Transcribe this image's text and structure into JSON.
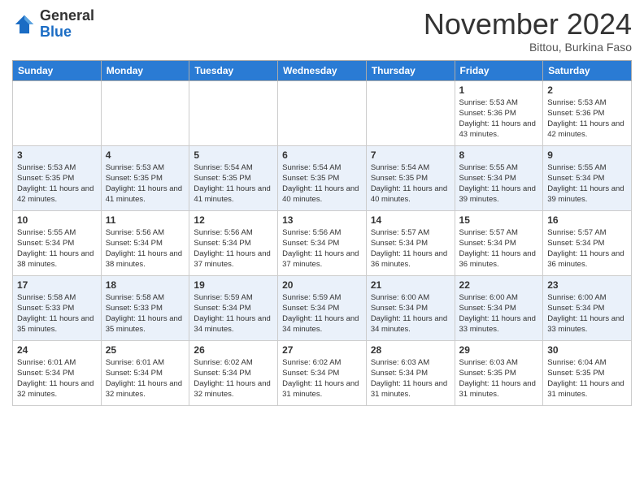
{
  "header": {
    "logo_general": "General",
    "logo_blue": "Blue",
    "month_title": "November 2024",
    "location": "Bittou, Burkina Faso"
  },
  "weekdays": [
    "Sunday",
    "Monday",
    "Tuesday",
    "Wednesday",
    "Thursday",
    "Friday",
    "Saturday"
  ],
  "weeks": [
    [
      {
        "day": "",
        "info": ""
      },
      {
        "day": "",
        "info": ""
      },
      {
        "day": "",
        "info": ""
      },
      {
        "day": "",
        "info": ""
      },
      {
        "day": "",
        "info": ""
      },
      {
        "day": "1",
        "info": "Sunrise: 5:53 AM\nSunset: 5:36 PM\nDaylight: 11 hours\nand 43 minutes."
      },
      {
        "day": "2",
        "info": "Sunrise: 5:53 AM\nSunset: 5:36 PM\nDaylight: 11 hours\nand 42 minutes."
      }
    ],
    [
      {
        "day": "3",
        "info": "Sunrise: 5:53 AM\nSunset: 5:35 PM\nDaylight: 11 hours\nand 42 minutes."
      },
      {
        "day": "4",
        "info": "Sunrise: 5:53 AM\nSunset: 5:35 PM\nDaylight: 11 hours\nand 41 minutes."
      },
      {
        "day": "5",
        "info": "Sunrise: 5:54 AM\nSunset: 5:35 PM\nDaylight: 11 hours\nand 41 minutes."
      },
      {
        "day": "6",
        "info": "Sunrise: 5:54 AM\nSunset: 5:35 PM\nDaylight: 11 hours\nand 40 minutes."
      },
      {
        "day": "7",
        "info": "Sunrise: 5:54 AM\nSunset: 5:35 PM\nDaylight: 11 hours\nand 40 minutes."
      },
      {
        "day": "8",
        "info": "Sunrise: 5:55 AM\nSunset: 5:34 PM\nDaylight: 11 hours\nand 39 minutes."
      },
      {
        "day": "9",
        "info": "Sunrise: 5:55 AM\nSunset: 5:34 PM\nDaylight: 11 hours\nand 39 minutes."
      }
    ],
    [
      {
        "day": "10",
        "info": "Sunrise: 5:55 AM\nSunset: 5:34 PM\nDaylight: 11 hours\nand 38 minutes."
      },
      {
        "day": "11",
        "info": "Sunrise: 5:56 AM\nSunset: 5:34 PM\nDaylight: 11 hours\nand 38 minutes."
      },
      {
        "day": "12",
        "info": "Sunrise: 5:56 AM\nSunset: 5:34 PM\nDaylight: 11 hours\nand 37 minutes."
      },
      {
        "day": "13",
        "info": "Sunrise: 5:56 AM\nSunset: 5:34 PM\nDaylight: 11 hours\nand 37 minutes."
      },
      {
        "day": "14",
        "info": "Sunrise: 5:57 AM\nSunset: 5:34 PM\nDaylight: 11 hours\nand 36 minutes."
      },
      {
        "day": "15",
        "info": "Sunrise: 5:57 AM\nSunset: 5:34 PM\nDaylight: 11 hours\nand 36 minutes."
      },
      {
        "day": "16",
        "info": "Sunrise: 5:57 AM\nSunset: 5:34 PM\nDaylight: 11 hours\nand 36 minutes."
      }
    ],
    [
      {
        "day": "17",
        "info": "Sunrise: 5:58 AM\nSunset: 5:33 PM\nDaylight: 11 hours\nand 35 minutes."
      },
      {
        "day": "18",
        "info": "Sunrise: 5:58 AM\nSunset: 5:33 PM\nDaylight: 11 hours\nand 35 minutes."
      },
      {
        "day": "19",
        "info": "Sunrise: 5:59 AM\nSunset: 5:34 PM\nDaylight: 11 hours\nand 34 minutes."
      },
      {
        "day": "20",
        "info": "Sunrise: 5:59 AM\nSunset: 5:34 PM\nDaylight: 11 hours\nand 34 minutes."
      },
      {
        "day": "21",
        "info": "Sunrise: 6:00 AM\nSunset: 5:34 PM\nDaylight: 11 hours\nand 34 minutes."
      },
      {
        "day": "22",
        "info": "Sunrise: 6:00 AM\nSunset: 5:34 PM\nDaylight: 11 hours\nand 33 minutes."
      },
      {
        "day": "23",
        "info": "Sunrise: 6:00 AM\nSunset: 5:34 PM\nDaylight: 11 hours\nand 33 minutes."
      }
    ],
    [
      {
        "day": "24",
        "info": "Sunrise: 6:01 AM\nSunset: 5:34 PM\nDaylight: 11 hours\nand 32 minutes."
      },
      {
        "day": "25",
        "info": "Sunrise: 6:01 AM\nSunset: 5:34 PM\nDaylight: 11 hours\nand 32 minutes."
      },
      {
        "day": "26",
        "info": "Sunrise: 6:02 AM\nSunset: 5:34 PM\nDaylight: 11 hours\nand 32 minutes."
      },
      {
        "day": "27",
        "info": "Sunrise: 6:02 AM\nSunset: 5:34 PM\nDaylight: 11 hours\nand 31 minutes."
      },
      {
        "day": "28",
        "info": "Sunrise: 6:03 AM\nSunset: 5:34 PM\nDaylight: 11 hours\nand 31 minutes."
      },
      {
        "day": "29",
        "info": "Sunrise: 6:03 AM\nSunset: 5:35 PM\nDaylight: 11 hours\nand 31 minutes."
      },
      {
        "day": "30",
        "info": "Sunrise: 6:04 AM\nSunset: 5:35 PM\nDaylight: 11 hours\nand 31 minutes."
      }
    ]
  ]
}
